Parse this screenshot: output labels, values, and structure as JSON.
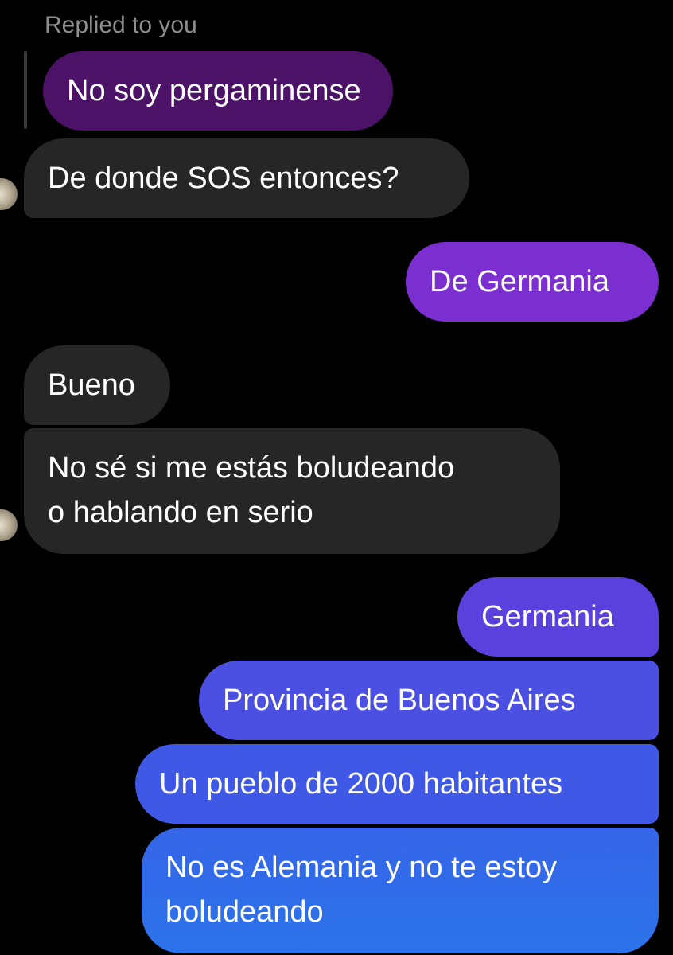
{
  "reply_context": {
    "label": "Replied to you",
    "quoted_message": "No soy pergaminense"
  },
  "messages": [
    {
      "sender": "them",
      "text": "De donde SOS entonces?"
    },
    {
      "sender": "me",
      "text": "De Germania"
    },
    {
      "sender": "them",
      "text": "Bueno"
    },
    {
      "sender": "them",
      "text": "No sé si me estás boludeando\no hablando en serio"
    },
    {
      "sender": "me",
      "text": "Germania"
    },
    {
      "sender": "me",
      "text": "Provincia de Buenos Aires"
    },
    {
      "sender": "me",
      "text": "Un pueblo de 2000 habitantes"
    },
    {
      "sender": "me",
      "text": "No es Alemania y no te estoy\nboludeando"
    }
  ],
  "colors": {
    "background": "#000000",
    "incoming_bubble": "#262626",
    "quoted_bubble": "#4b1267",
    "outgoing_gradient": [
      "#7b2fd0",
      "#5a40dd",
      "#3f59e6",
      "#2b73ea"
    ],
    "secondary_text": "#8e8e8e"
  }
}
